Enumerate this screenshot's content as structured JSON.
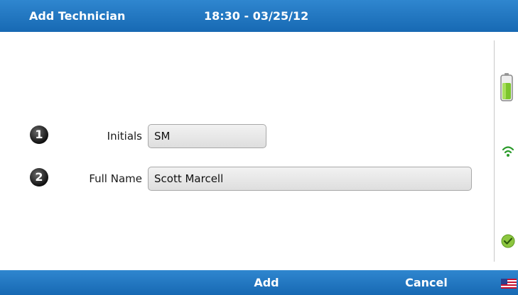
{
  "header": {
    "title": "Add Technician",
    "datetime": "18:30 - 03/25/12"
  },
  "form": {
    "fields": [
      {
        "step": "1",
        "label": "Initials",
        "value": "SM"
      },
      {
        "step": "2",
        "label": "Full Name",
        "value": "Scott Marcell"
      }
    ]
  },
  "footer": {
    "add_label": "Add",
    "cancel_label": "Cancel"
  },
  "status_icons": [
    "battery-icon",
    "wifi-icon",
    "check-icon",
    "flag-icon"
  ],
  "colors": {
    "bar": "#1f74c0",
    "battery": "#7cc52d",
    "wifi": "#2a9a2a",
    "check": "#8cc63f"
  }
}
